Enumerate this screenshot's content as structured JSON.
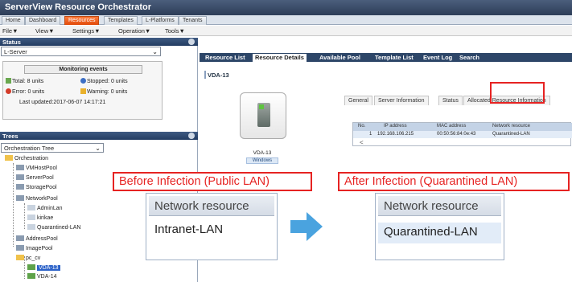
{
  "app": {
    "title": "ServerView Resource Orchestrator"
  },
  "top_tabs": [
    "Home",
    "Dashboard",
    "Resources",
    "Templates",
    "L-Platforms",
    "Tenants"
  ],
  "menu": [
    "File▼",
    "View▼",
    "Settings▼",
    "Operation▼",
    "Tools▼"
  ],
  "status_panel": {
    "title": "Status",
    "select_value": "L-Server",
    "monitoring_title": "Monitoring events",
    "total": "Total: 8 units",
    "stopped": "Stopped: 0 units",
    "error": "Error: 0 units",
    "warning": "Warning: 0 units",
    "last_updated": "Last updated:2017-06-07 14:17:21"
  },
  "trees_panel": {
    "title": "Trees",
    "select_value": "Orchestration Tree",
    "items": [
      "Orchestration",
      "VMHostPool",
      "ServerPool",
      "StoragePool",
      "NetworkPool",
      "AdminLan",
      "kirikae",
      "Quarantined-LAN",
      "AddressPool",
      "ImagePool",
      "pc_cv",
      "VDA-13",
      "VDA-14"
    ]
  },
  "resource_tabs": [
    "Resource List",
    "Resource Details",
    "Available Pool",
    "Template List",
    "Event Log",
    "Search"
  ],
  "details": {
    "title": "VDA-13",
    "server_label": "VDA-13",
    "os_label": "Windows",
    "detail_tabs": [
      "General",
      "Server Information",
      "Status",
      "Allocated Resource Information"
    ],
    "grid_headers": [
      "No.",
      "IP address",
      "MAC address",
      "Network resource"
    ],
    "grid_row": [
      "1",
      "192.168.106.215",
      "00:50:56:84:0e:43",
      "Quarantined-LAN"
    ]
  },
  "callouts": {
    "before": "Before Infection (Public LAN)",
    "after": "After Infection (Quarantined LAN)"
  },
  "zoom_before": {
    "header": "Network resource",
    "value": "Intranet-LAN"
  },
  "zoom_after": {
    "header": "Network resource",
    "value": "Quarantined-LAN"
  },
  "colors": {
    "accent_red": "#e62322",
    "arrow_blue": "#4aa3df",
    "active_tab": "#e04a0a"
  }
}
